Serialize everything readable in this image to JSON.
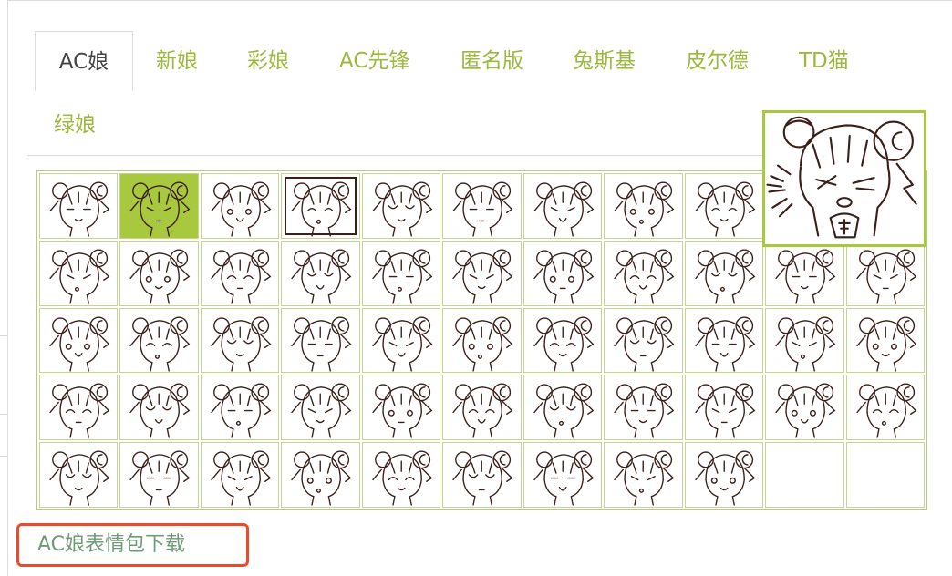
{
  "tabs": [
    {
      "label": "AC娘",
      "name": "tab-ac-niang",
      "active": true
    },
    {
      "label": "新娘",
      "name": "tab-xin-niang",
      "active": false
    },
    {
      "label": "彩娘",
      "name": "tab-cai-niang",
      "active": false
    },
    {
      "label": "AC先锋",
      "name": "tab-ac-vanguard",
      "active": false
    },
    {
      "label": "匿名版",
      "name": "tab-anonymous",
      "active": false
    },
    {
      "label": "兔斯基",
      "name": "tab-tuzki",
      "active": false
    },
    {
      "label": "皮尔德",
      "name": "tab-pierde",
      "active": false
    },
    {
      "label": "TD猫",
      "name": "tab-td-cat",
      "active": false
    },
    {
      "label": "绿娘",
      "name": "tab-lv-niang",
      "active": false
    }
  ],
  "emoticon_grid": {
    "rows": 5,
    "columns": 11,
    "count": 53,
    "selected_index": 1,
    "icon": "ac-niang-emoticon-icon"
  },
  "preview": {
    "icon": "ac-niang-blowing-preview-icon"
  },
  "download_link": "AC娘表情包下载",
  "colors": {
    "accent_green": "#a8c83e",
    "tab_text": "#9bb93d",
    "active_tab_text": "#444444",
    "grid_border": "#b7cc78",
    "highlight_box": "#ec4a2e",
    "link_text": "#6f9a7a",
    "line_art": "#3a1f1a"
  }
}
